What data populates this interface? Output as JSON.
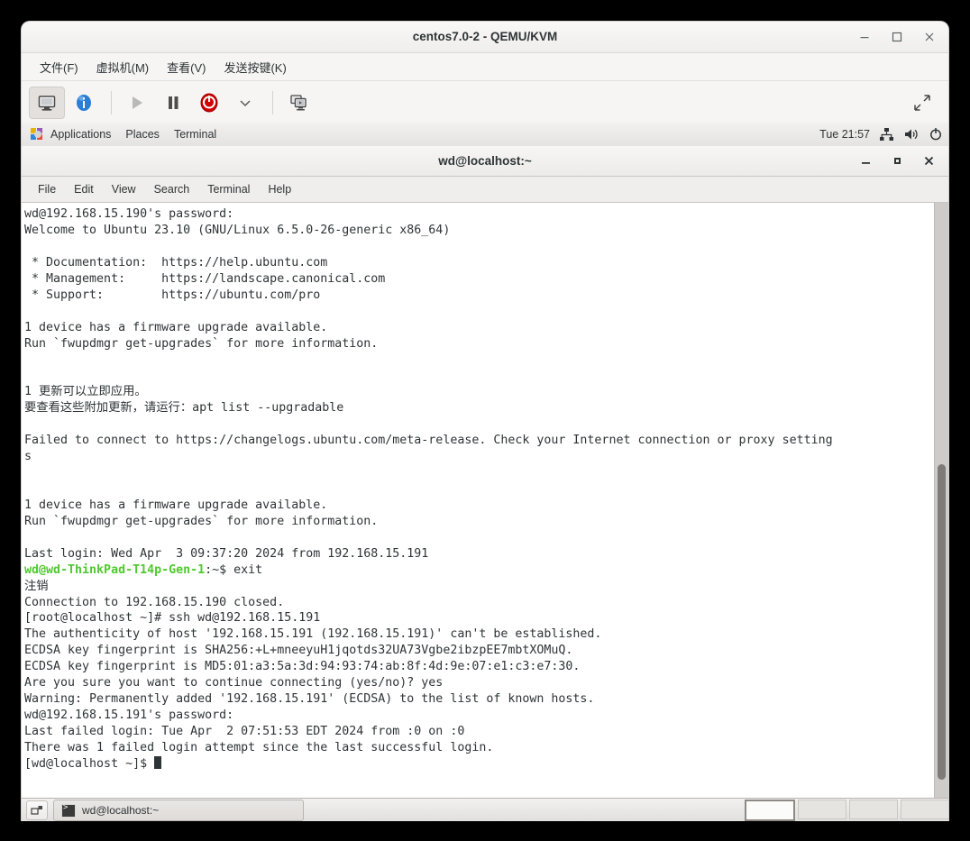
{
  "vm_window": {
    "title": "centos7.0-2 - QEMU/KVM",
    "window_buttons": [
      {
        "name": "minimize",
        "glyph": "minimize-icon"
      },
      {
        "name": "maximize",
        "glyph": "maximize-icon"
      },
      {
        "name": "close",
        "glyph": "close-icon"
      }
    ],
    "menubar": [
      {
        "label": "文件(F)",
        "name": "menu-file"
      },
      {
        "label": "虚拟机(M)",
        "name": "menu-virtual-machine"
      },
      {
        "label": "查看(V)",
        "name": "menu-view"
      },
      {
        "label": "发送按键(K)",
        "name": "menu-send-key"
      }
    ],
    "toolbar": [
      {
        "name": "console-view-button",
        "icon": "monitor-icon",
        "state": "active"
      },
      {
        "name": "vm-details-button",
        "icon": "info-icon",
        "state": "normal"
      },
      {
        "name": "run-button",
        "icon": "play-icon",
        "state": "disabled"
      },
      {
        "name": "pause-button",
        "icon": "pause-icon",
        "state": "normal"
      },
      {
        "name": "shutdown-button",
        "icon": "power-icon",
        "state": "normal"
      },
      {
        "name": "shutdown-options-button",
        "icon": "chevron-down-icon",
        "state": "normal"
      },
      {
        "name": "snapshots-button",
        "icon": "screens-icon",
        "state": "normal"
      }
    ],
    "expand_button": {
      "name": "fullscreen-button",
      "icon": "expand-arrows-icon"
    }
  },
  "gnome_panel": {
    "applications_label": "Applications",
    "places_label": "Places",
    "terminal_label": "Terminal",
    "clock": "Tue 21:57",
    "tray": [
      {
        "name": "network-icon"
      },
      {
        "name": "volume-icon"
      },
      {
        "name": "power-icon"
      }
    ]
  },
  "terminal_window": {
    "title": "wd@localhost:~",
    "window_buttons": [
      {
        "name": "minimize",
        "glyph": "minimize-icon"
      },
      {
        "name": "maximize",
        "glyph": "maximize-icon"
      },
      {
        "name": "close",
        "glyph": "close-icon"
      }
    ],
    "menubar": [
      {
        "label": "File",
        "name": "term-menu-file"
      },
      {
        "label": "Edit",
        "name": "term-menu-edit"
      },
      {
        "label": "View",
        "name": "term-menu-view"
      },
      {
        "label": "Search",
        "name": "term-menu-search"
      },
      {
        "label": "Terminal",
        "name": "term-menu-terminal"
      },
      {
        "label": "Help",
        "name": "term-menu-help"
      }
    ],
    "lines": [
      {
        "text": "wd@192.168.15.190's password:"
      },
      {
        "text": "Welcome to Ubuntu 23.10 (GNU/Linux 6.5.0-26-generic x86_64)"
      },
      {
        "text": ""
      },
      {
        "text": " * Documentation:  https://help.ubuntu.com"
      },
      {
        "text": " * Management:     https://landscape.canonical.com"
      },
      {
        "text": " * Support:        https://ubuntu.com/pro"
      },
      {
        "text": ""
      },
      {
        "text": "1 device has a firmware upgrade available."
      },
      {
        "text": "Run `fwupdmgr get-upgrades` for more information."
      },
      {
        "text": ""
      },
      {
        "text": ""
      },
      {
        "text": "1 更新可以立即应用。"
      },
      {
        "text": "要查看这些附加更新，请运行：apt list --upgradable"
      },
      {
        "text": ""
      },
      {
        "text": "Failed to connect to https://changelogs.ubuntu.com/meta-release. Check your Internet connection or proxy setting"
      },
      {
        "text": "s"
      },
      {
        "text": ""
      },
      {
        "text": ""
      },
      {
        "text": "1 device has a firmware upgrade available."
      },
      {
        "text": "Run `fwupdmgr get-upgrades` for more information."
      },
      {
        "text": ""
      },
      {
        "text": "Last login: Wed Apr  3 09:37:20 2024 from 192.168.15.191"
      },
      {
        "prompt": "wd@wd-ThinkPad-T14p-Gen-1",
        "text": ":~$ exit"
      },
      {
        "text": "注销"
      },
      {
        "text": "Connection to 192.168.15.190 closed."
      },
      {
        "text": "[root@localhost ~]# ssh wd@192.168.15.191"
      },
      {
        "text": "The authenticity of host '192.168.15.191 (192.168.15.191)' can't be established."
      },
      {
        "text": "ECDSA key fingerprint is SHA256:+L+mneeyuH1jqotds32UA73Vgbe2ibzpEE7mbtXOMuQ."
      },
      {
        "text": "ECDSA key fingerprint is MD5:01:a3:5a:3d:94:93:74:ab:8f:4d:9e:07:e1:c3:e7:30."
      },
      {
        "text": "Are you sure you want to continue connecting (yes/no)? yes"
      },
      {
        "text": "Warning: Permanently added '192.168.15.191' (ECDSA) to the list of known hosts."
      },
      {
        "text": "wd@192.168.15.191's password:"
      },
      {
        "text": "Last failed login: Tue Apr  2 07:51:53 EDT 2024 from :0 on :0"
      },
      {
        "text": "There was 1 failed login attempt since the last successful login."
      },
      {
        "text": "[wd@localhost ~]$ ",
        "cursor": true
      }
    ]
  },
  "taskbar": {
    "show_desktop": {
      "name": "show-desktop-button"
    },
    "tasks": [
      {
        "label": "wd@localhost:~",
        "name": "taskbar-item-terminal"
      }
    ],
    "workspaces": [
      {
        "active": true
      },
      {
        "active": false
      },
      {
        "active": false
      },
      {
        "active": false
      }
    ]
  },
  "colors": {
    "prompt_green": "#4ec92e",
    "terminal_fg": "#2e3436",
    "terminal_bg": "#ffffff",
    "chrome_bg": "#f6f5f4",
    "power_red": "#d00000",
    "info_blue": "#2a7fd4"
  }
}
